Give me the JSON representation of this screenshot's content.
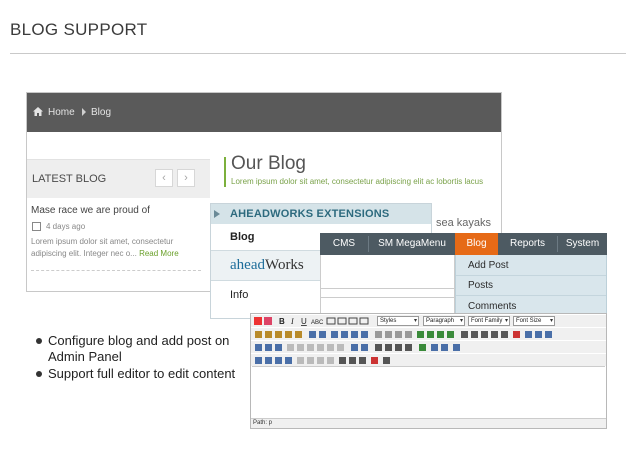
{
  "header": {
    "title": "BLOG SUPPORT"
  },
  "storefront": {
    "breadcrumb": {
      "home": "Home",
      "current": "Blog"
    },
    "latest_blog": {
      "title": "LATEST BLOG",
      "prev_icon": "‹",
      "next_icon": "›",
      "post_title": "Mase race we are proud of",
      "post_date": "4 days ago",
      "post_excerpt": "Lorem ipsum dolor sit amet, consectetur adipiscing elit. Integer nec o...",
      "read_more": "Read More"
    },
    "page_title": "Our Blog",
    "page_subtitle": "Lorem ipsum dolor sit amet, consectetur adipiscing elit ac lobortis lacus",
    "side_text": "sea kayaks"
  },
  "extensions_panel": {
    "heading": "AHEADWORKS EXTENSIONS",
    "blog_item": "Blog",
    "logo_part1": "ahead",
    "logo_part2": "Works",
    "info_item": "Info"
  },
  "admin_menu": {
    "items": [
      "CMS",
      "SM MegaMenu",
      "Blog",
      "Reports",
      "System"
    ],
    "active": "Blog",
    "dropdown": [
      "Add Post",
      "Posts",
      "Comments"
    ],
    "accent": "#e66a17"
  },
  "editor": {
    "styles_select": "Styles",
    "paragraph_select": "Paragraph",
    "font_family_select": "Font Family",
    "font_size_select": "Font Size",
    "path": "Path: p"
  },
  "features": [
    "Configure blog and add post on Admin Panel",
    "Support full editor to edit content"
  ]
}
